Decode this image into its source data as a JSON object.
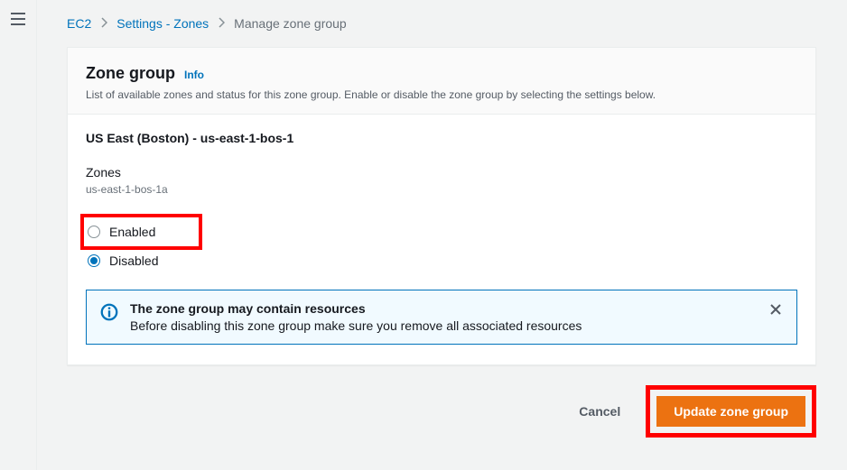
{
  "breadcrumb": {
    "root": "EC2",
    "parent": "Settings - Zones",
    "current": "Manage zone group"
  },
  "panel": {
    "title": "Zone group",
    "info_label": "Info",
    "subtitle": "List of available zones and status for this zone group. Enable or disable the zone group by selecting the settings below."
  },
  "zone_group": {
    "name": "US East (Boston) - us-east-1-bos-1",
    "zones_label": "Zones",
    "zone_id": "us-east-1-bos-1a"
  },
  "status": {
    "enabled_label": "Enabled",
    "disabled_label": "Disabled",
    "selected": "disabled"
  },
  "alert": {
    "title": "The zone group may contain resources",
    "text": "Before disabling this zone group make sure you remove all associated resources"
  },
  "actions": {
    "cancel": "Cancel",
    "update": "Update zone group"
  }
}
